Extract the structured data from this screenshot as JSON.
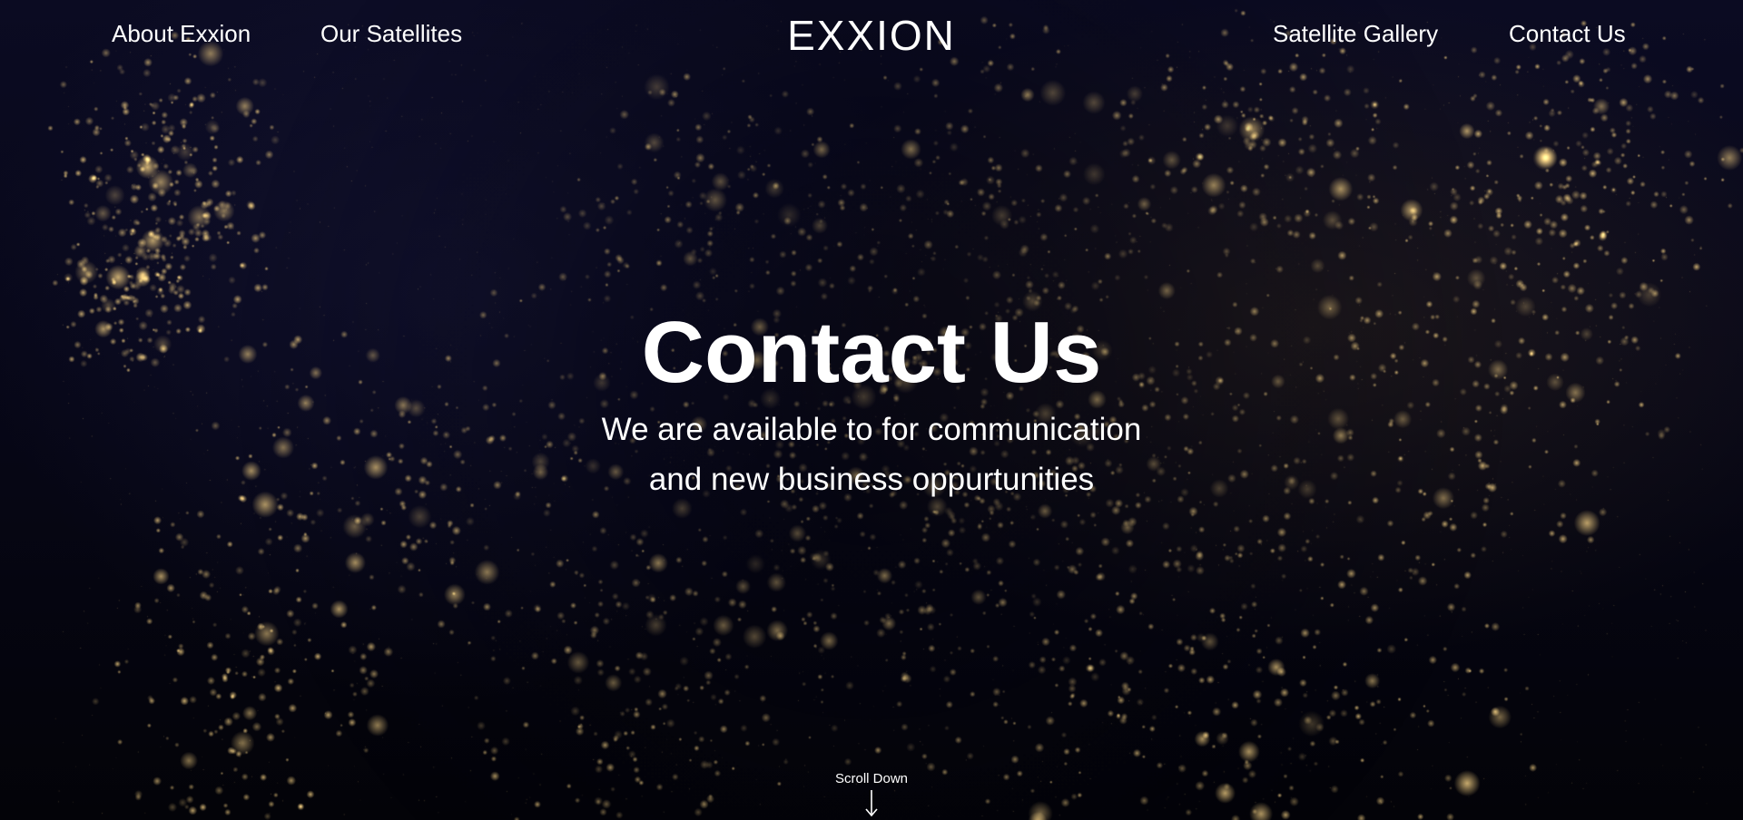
{
  "nav": {
    "left": [
      {
        "label": "About Exxion"
      },
      {
        "label": "Our Satellites"
      }
    ],
    "logo": "EXXION",
    "right": [
      {
        "label": "Satellite Gallery"
      },
      {
        "label": "Contact Us"
      }
    ]
  },
  "hero": {
    "title": "Contact Us",
    "subtitle_line1": "We are available to for communication",
    "subtitle_line2": "and new business oppurtunities",
    "scroll_label": "Scroll Down",
    "scroll_icon": "arrow-down-icon",
    "background_image": "night-city-lights-map"
  },
  "colors": {
    "text": "#ffffff",
    "background": "#05050f",
    "city_lights": "#e8c27a"
  }
}
